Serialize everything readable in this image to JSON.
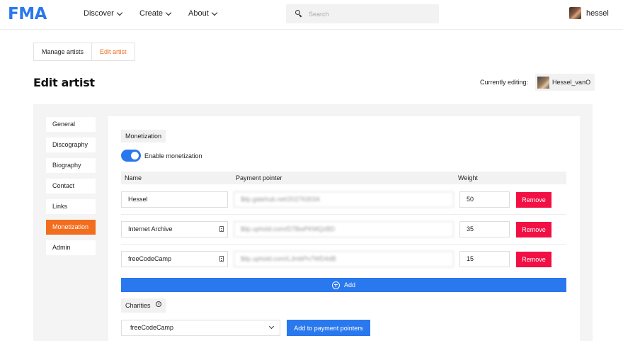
{
  "brand": {
    "logo": "FMA"
  },
  "nav": {
    "items": [
      {
        "label": "Discover"
      },
      {
        "label": "Create"
      },
      {
        "label": "About"
      }
    ],
    "search_placeholder": "Search",
    "user": "hessel"
  },
  "breadcrumb": [
    {
      "label": "Manage artists"
    },
    {
      "label": "Edit artist"
    }
  ],
  "page": {
    "title": "Edit artist",
    "editing_label": "Currently editing:",
    "editing_artist": "Hessel_vanO"
  },
  "sidebar": {
    "items": [
      {
        "label": "General"
      },
      {
        "label": "Discography"
      },
      {
        "label": "Biography"
      },
      {
        "label": "Contact"
      },
      {
        "label": "Links"
      },
      {
        "label": "Monetization"
      },
      {
        "label": "Admin"
      }
    ],
    "active": "Monetization"
  },
  "monetization": {
    "section_label": "Monetization",
    "enable_label": "Enable monetization",
    "enabled": true,
    "columns": {
      "name": "Name",
      "pointer": "Payment pointer",
      "weight": "Weight"
    },
    "rows": [
      {
        "name": "Hessel",
        "pointer": "$ilp.gatehub.net/202763034",
        "weight": "50",
        "remove": "Remove"
      },
      {
        "name": "Internet Archive",
        "pointer": "$ilp.uphold.com/D7BwPKMQzBD",
        "weight": "35",
        "remove": "Remove"
      },
      {
        "name": "freeCodeCamp",
        "pointer": "$ilp.uphold.com/LJmbPn7WD4dB",
        "weight": "15",
        "remove": "Remove"
      }
    ],
    "add_label": "Add",
    "charities_label": "Charities",
    "charity_selected": "freeCodeCamp",
    "add_to_pointers_label": "Add to payment pointers"
  },
  "colors": {
    "accent": "#2a78ee",
    "active_orange": "#f26d1d",
    "danger": "#f20f43"
  }
}
